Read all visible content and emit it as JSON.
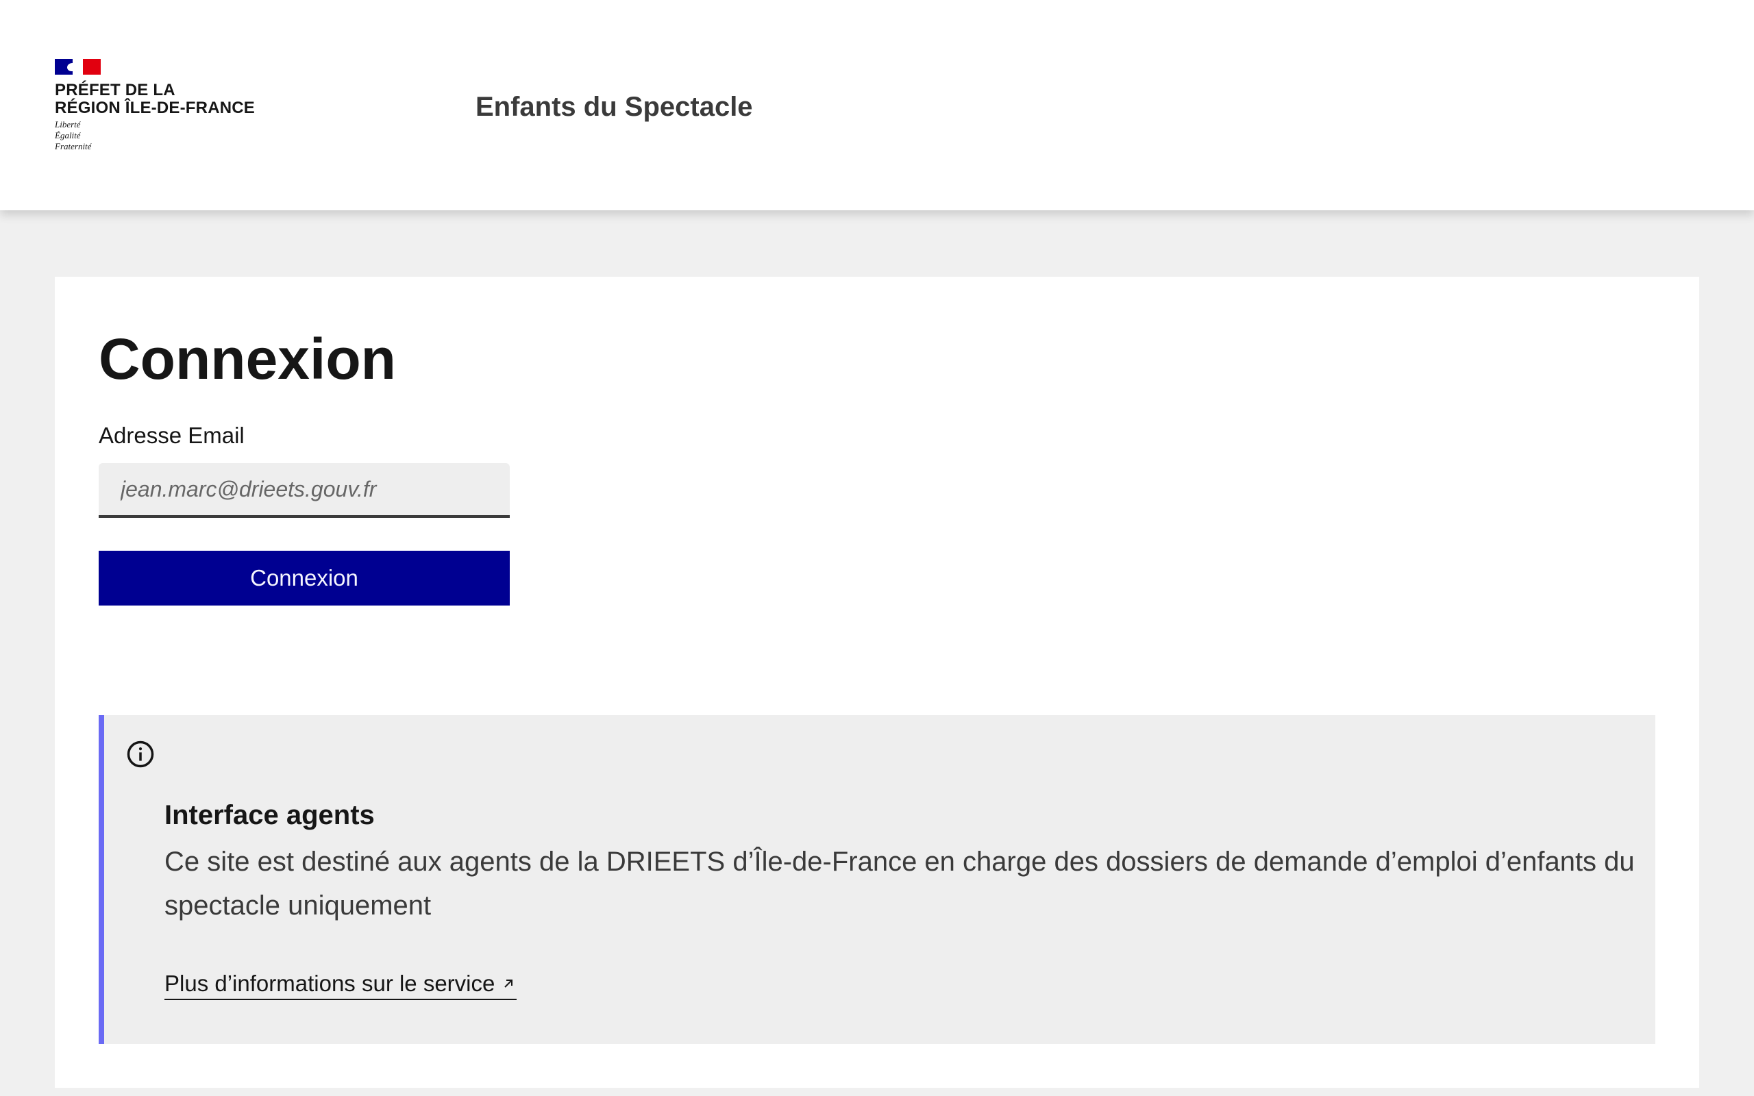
{
  "header": {
    "org_name_line1": "PRÉFET DE LA",
    "org_name_line2": "RÉGION ÎLE-DE-FRANCE",
    "motto": [
      "Liberté",
      "Égalité",
      "Fraternité"
    ],
    "service_title": "Enfants du Spectacle"
  },
  "login": {
    "title": "Connexion",
    "email_label": "Adresse Email",
    "email_placeholder": "jean.marc@drieets.gouv.fr",
    "email_value": "",
    "submit_label": "Connexion"
  },
  "callout": {
    "icon": "info-icon",
    "title": "Interface agents",
    "text": "Ce site est destiné aux agents de la DRIEETS d’Île-de-France en charge des dossiers de demande d’emploi d’enfants du spectacle uniquement",
    "link_label": "Plus d’informations sur le service",
    "link_icon": "external-link-icon"
  },
  "colors": {
    "primary": "#000091",
    "callout_accent": "#6a6af4",
    "page_background": "#f0f0f0",
    "marianne_red": "#e1000f"
  }
}
